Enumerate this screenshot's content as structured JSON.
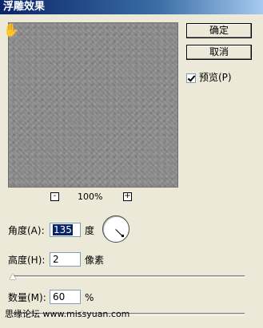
{
  "window": {
    "title": "浮雕效果"
  },
  "buttons": {
    "ok": "确定",
    "cancel": "取消"
  },
  "preview_checkbox": {
    "label": "预览(P)",
    "checked": true
  },
  "zoom": {
    "minus": "-",
    "value": "100%",
    "plus": "+"
  },
  "angle": {
    "label": "角度(A):",
    "value": "135",
    "unit": "度"
  },
  "height": {
    "label": "高度(H):",
    "value": "2",
    "unit": "像素",
    "slider_fraction": 0.0
  },
  "amount": {
    "label": "数量(M):",
    "value": "60",
    "unit": "%",
    "slider_fraction": 0.3
  },
  "watermark": "思缘论坛 www.missyuan.com"
}
